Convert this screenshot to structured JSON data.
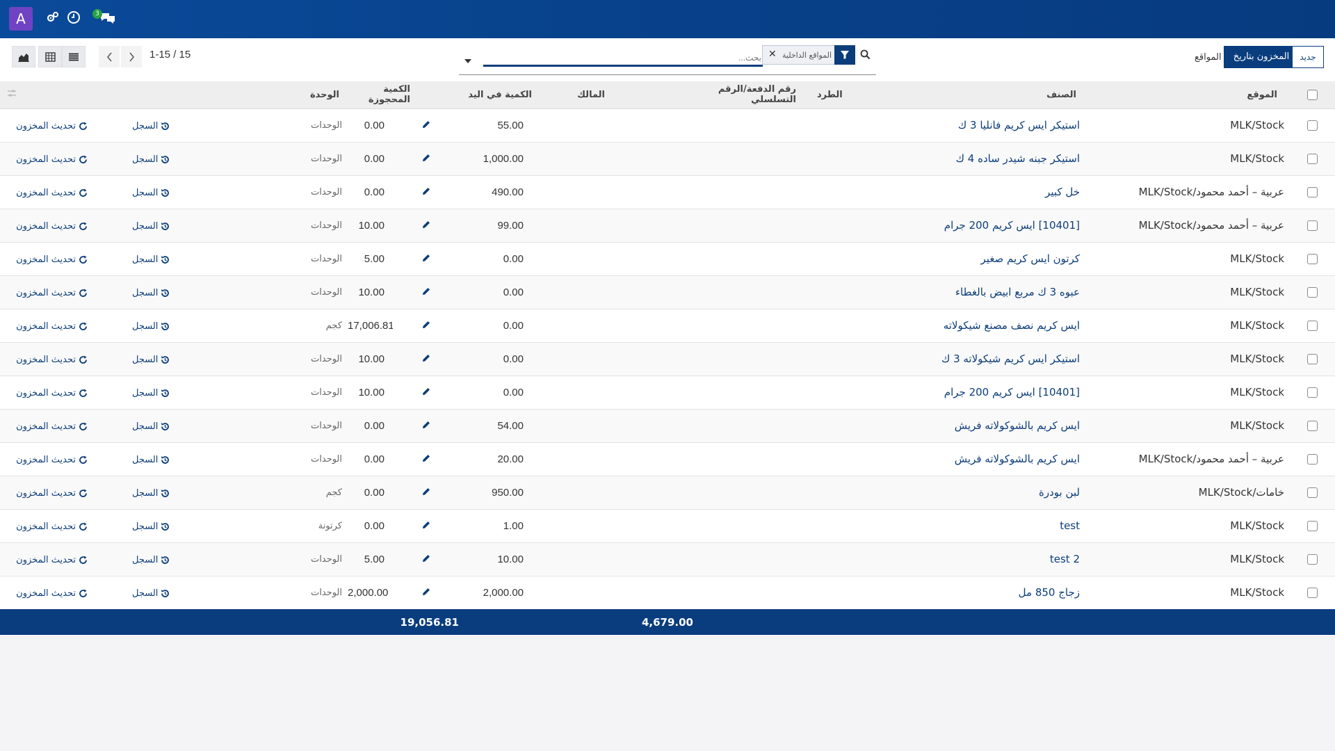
{
  "topbar": {
    "avatar_letter": "A",
    "chat_badge": "3"
  },
  "control_panel": {
    "new_button": "جديد",
    "stock_by_date_button": "المخزون بتاريخ",
    "locations_label": "المواقع",
    "search_placeholder": "بحث...",
    "facet_label": "المواقع الداخلية",
    "pager": "1-15 / 15"
  },
  "table": {
    "columns": {
      "location": "الموقع",
      "product": "الصنف",
      "package": "الطرد",
      "lot": "رقم الدفعة/الرقم التسلسلي",
      "owner": "المالك",
      "on_hand": "الكمية في اليد",
      "reserved": "الكمية المحجوزة",
      "unit": "الوحدة"
    },
    "history_label": "السجل",
    "update_label": "تحديث المخزون",
    "rows": [
      {
        "location": "MLK/Stock",
        "product": "استيكر ايس كريم فانليا 3 ك",
        "on_hand": "55.00",
        "reserved": "0.00",
        "unit": "الوحدات"
      },
      {
        "location": "MLK/Stock",
        "product": "استيكر جبنه شيدر ساده 4 ك",
        "on_hand": "1,000.00",
        "reserved": "0.00",
        "unit": "الوحدات"
      },
      {
        "location": "MLK/Stock/عربية – أحمد محمود",
        "product": "خل كبير",
        "on_hand": "490.00",
        "reserved": "0.00",
        "unit": "الوحدات"
      },
      {
        "location": "MLK/Stock/عربية – أحمد محمود",
        "product": "[10401] ايس كريم 200 جرام",
        "on_hand": "99.00",
        "reserved": "10.00",
        "unit": "الوحدات"
      },
      {
        "location": "MLK/Stock",
        "product": "كرتون ايس كريم صغير",
        "on_hand": "0.00",
        "reserved": "5.00",
        "unit": "الوحدات"
      },
      {
        "location": "MLK/Stock",
        "product": "عبوه 3 ك مربع ابيض بالغطاء",
        "on_hand": "0.00",
        "reserved": "10.00",
        "unit": "الوحدات"
      },
      {
        "location": "MLK/Stock",
        "product": "ايس كريم نصف مصنع شيكولاته",
        "on_hand": "0.00",
        "reserved": "17,006.81",
        "unit": "كجم"
      },
      {
        "location": "MLK/Stock",
        "product": "استيكر ايس كريم شيكولاته 3 ك",
        "on_hand": "0.00",
        "reserved": "10.00",
        "unit": "الوحدات"
      },
      {
        "location": "MLK/Stock",
        "product": "[10401] ايس كريم 200 جرام",
        "on_hand": "0.00",
        "reserved": "10.00",
        "unit": "الوحدات"
      },
      {
        "location": "MLK/Stock",
        "product": "ايس كريم بالشوكولاته فريش",
        "on_hand": "54.00",
        "reserved": "0.00",
        "unit": "الوحدات"
      },
      {
        "location": "MLK/Stock/عربية – أحمد محمود",
        "product": "ايس كريم بالشوكولاته فريش",
        "on_hand": "20.00",
        "reserved": "0.00",
        "unit": "الوحدات"
      },
      {
        "location": "MLK/Stock/خامات",
        "product": "لبن بودرة",
        "on_hand": "950.00",
        "reserved": "0.00",
        "unit": "كجم"
      },
      {
        "location": "MLK/Stock",
        "product": "test",
        "on_hand": "1.00",
        "reserved": "0.00",
        "unit": "كرتونة"
      },
      {
        "location": "MLK/Stock",
        "product": "test 2",
        "on_hand": "10.00",
        "reserved": "5.00",
        "unit": "الوحدات"
      },
      {
        "location": "MLK/Stock",
        "product": "زجاج 850 مل",
        "on_hand": "2,000.00",
        "reserved": "2,000.00",
        "unit": "الوحدات"
      }
    ],
    "totals": {
      "on_hand": "4,679.00",
      "reserved": "19,056.81"
    }
  },
  "colors": {
    "topbar": "#0a4a9a",
    "primary": "#0a3d7e",
    "avatar": "#7042c4",
    "badge": "#27a243"
  }
}
